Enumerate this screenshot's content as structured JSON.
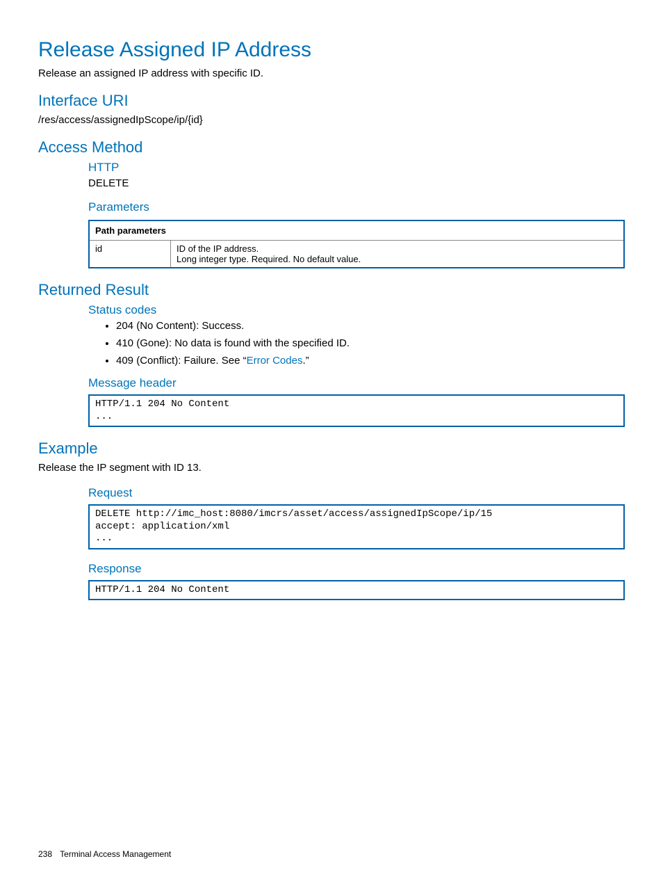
{
  "title": "Release Assigned IP Address",
  "description": "Release an assigned IP address with specific ID.",
  "interface_uri": {
    "heading": "Interface URI",
    "value": "/res/access/assignedIpScope/ip/{id}"
  },
  "access_method": {
    "heading": "Access Method",
    "http_heading": "HTTP",
    "http_method": "DELETE",
    "parameters_heading": "Parameters",
    "table": {
      "header": "Path parameters",
      "rows": [
        {
          "name": "id",
          "desc_line1": "ID of the IP address.",
          "desc_line2": "Long integer type. Required. No default value."
        }
      ]
    }
  },
  "returned_result": {
    "heading": "Returned Result",
    "status_heading": "Status codes",
    "codes": {
      "c0": "204 (No Content): Success.",
      "c1": "410 (Gone): No data is found with the specified ID.",
      "c2_pre": "409 (Conflict): Failure. See “",
      "c2_link": "Error Codes",
      "c2_post": ".”"
    },
    "msg_heading": "Message header",
    "msg_body": "HTTP/1.1 204 No Content\n..."
  },
  "example": {
    "heading": "Example",
    "intro": "Release the IP segment with ID 13.",
    "request_heading": "Request",
    "request_body": "DELETE http://imc_host:8080/imcrs/asset/access/assignedIpScope/ip/15\naccept: application/xml\n...",
    "response_heading": "Response",
    "response_body": "HTTP/1.1 204 No Content"
  },
  "footer": {
    "page": "238",
    "section": "Terminal Access Management"
  }
}
